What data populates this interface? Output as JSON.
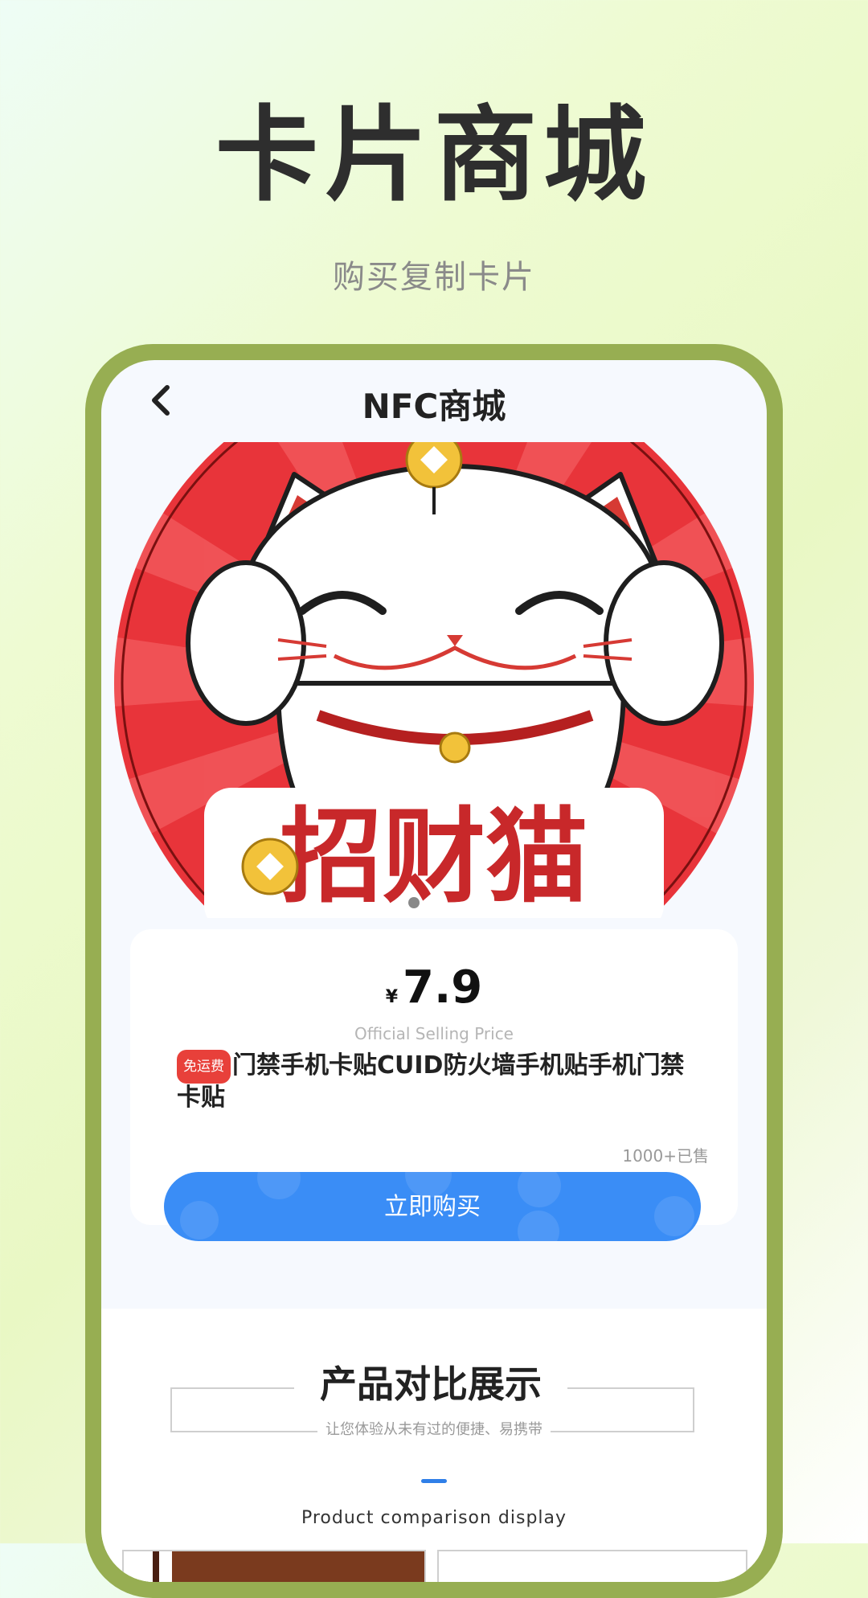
{
  "hero": {
    "title": "卡片商城",
    "subtitle": "购买复制卡片"
  },
  "nav": {
    "back_icon": "chevron-left-icon",
    "title": "NFC商城"
  },
  "banner": {
    "image_text": "招财猫",
    "slide_count_indicator": "1"
  },
  "product": {
    "currency": "¥",
    "price": "7.9",
    "price_caption": "Official Selling Price",
    "badge": "免运费",
    "title": "门禁手机卡贴CUID防火墙手机贴手机门禁卡贴",
    "sold": "1000+已售",
    "buy_label": "立即购买"
  },
  "compare": {
    "title": "产品对比展示",
    "subtitle": "让您体验从未有过的便捷、易携带",
    "subtitle_en": "Product comparison display"
  },
  "colors": {
    "frame": "#97ae52",
    "accent_blue": "#3a8df6",
    "badge_red": "#e8403a"
  }
}
